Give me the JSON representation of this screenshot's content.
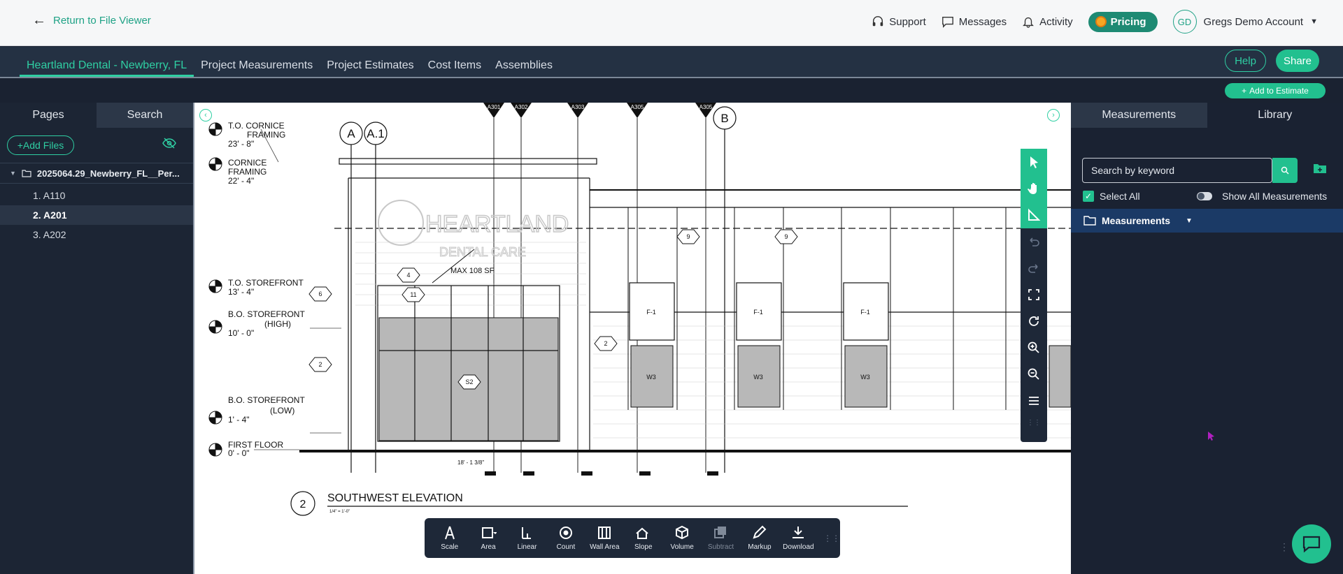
{
  "topbar": {
    "back_label": "Return to File Viewer",
    "support": "Support",
    "messages": "Messages",
    "activity": "Activity",
    "pricing": "Pricing",
    "avatar_initials": "GD",
    "account_name": "Gregs Demo Account"
  },
  "nav": {
    "tabs": [
      "Heartland Dental - Newberry, FL",
      "Project Measurements",
      "Project Estimates",
      "Cost Items",
      "Assemblies"
    ],
    "help": "Help",
    "share": "Share",
    "add_to_estimate": "Add to Estimate"
  },
  "left": {
    "tab_pages": "Pages",
    "tab_search": "Search",
    "add_files": "+Add Files",
    "folder_name": "2025064.29_Newberry_FL__Per...",
    "pages": [
      "1.  A110",
      "2.  A201",
      "3.  A202"
    ]
  },
  "drawing": {
    "levels": [
      {
        "name": "T.O. CORNICE",
        "name2": "FRAMING",
        "elev": "23' - 8\""
      },
      {
        "name": "CORNICE",
        "name2": "FRAMING",
        "elev": "22' - 4\""
      },
      {
        "name": "T.O. STOREFRONT",
        "name2": "",
        "elev": "13' - 4\""
      },
      {
        "name": "B.O. STOREFRONT",
        "name2": "(HIGH)",
        "elev": "10' - 0\""
      },
      {
        "name": "B.O. STOREFRONT",
        "name2": "(LOW)",
        "elev": "1' - 4\""
      },
      {
        "name": "FIRST FLOOR",
        "name2": "",
        "elev": "0' - 0\""
      }
    ],
    "grid_a": "A",
    "grid_a1": "A.1",
    "grid_b": "B",
    "signage_text": "MAX 108 SF",
    "sign_line1": "HEARTLAND",
    "sign_line2": "DENTAL CARE",
    "title_number": "2",
    "title": "SOUTHWEST ELEVATION",
    "scale_note": "1/4\" = 1'-0\"",
    "dimension": "18' - 1 3/8\"",
    "sections": [
      "A301",
      "A302",
      "A303",
      "A305",
      "A305"
    ]
  },
  "toolbar": {
    "tools": [
      {
        "label": "Scale",
        "icon": "compass-icon"
      },
      {
        "label": "Area",
        "icon": "area-icon"
      },
      {
        "label": "Linear",
        "icon": "linear-icon"
      },
      {
        "label": "Count",
        "icon": "count-icon"
      },
      {
        "label": "Wall Area",
        "icon": "wall-area-icon"
      },
      {
        "label": "Slope",
        "icon": "slope-icon"
      },
      {
        "label": "Volume",
        "icon": "volume-icon"
      },
      {
        "label": "Subtract",
        "icon": "subtract-icon"
      },
      {
        "label": "Markup",
        "icon": "markup-icon"
      },
      {
        "label": "Download",
        "icon": "download-icon"
      }
    ]
  },
  "right": {
    "tab_measurements": "Measurements",
    "tab_library": "Library",
    "search_placeholder": "Search by keyword",
    "select_all": "Select All",
    "show_all": "Show All Measurements",
    "folder": "Measurements"
  },
  "colors": {
    "accent": "#22c08f",
    "nav_bg": "#243143",
    "panel_bg": "#1c2534"
  }
}
